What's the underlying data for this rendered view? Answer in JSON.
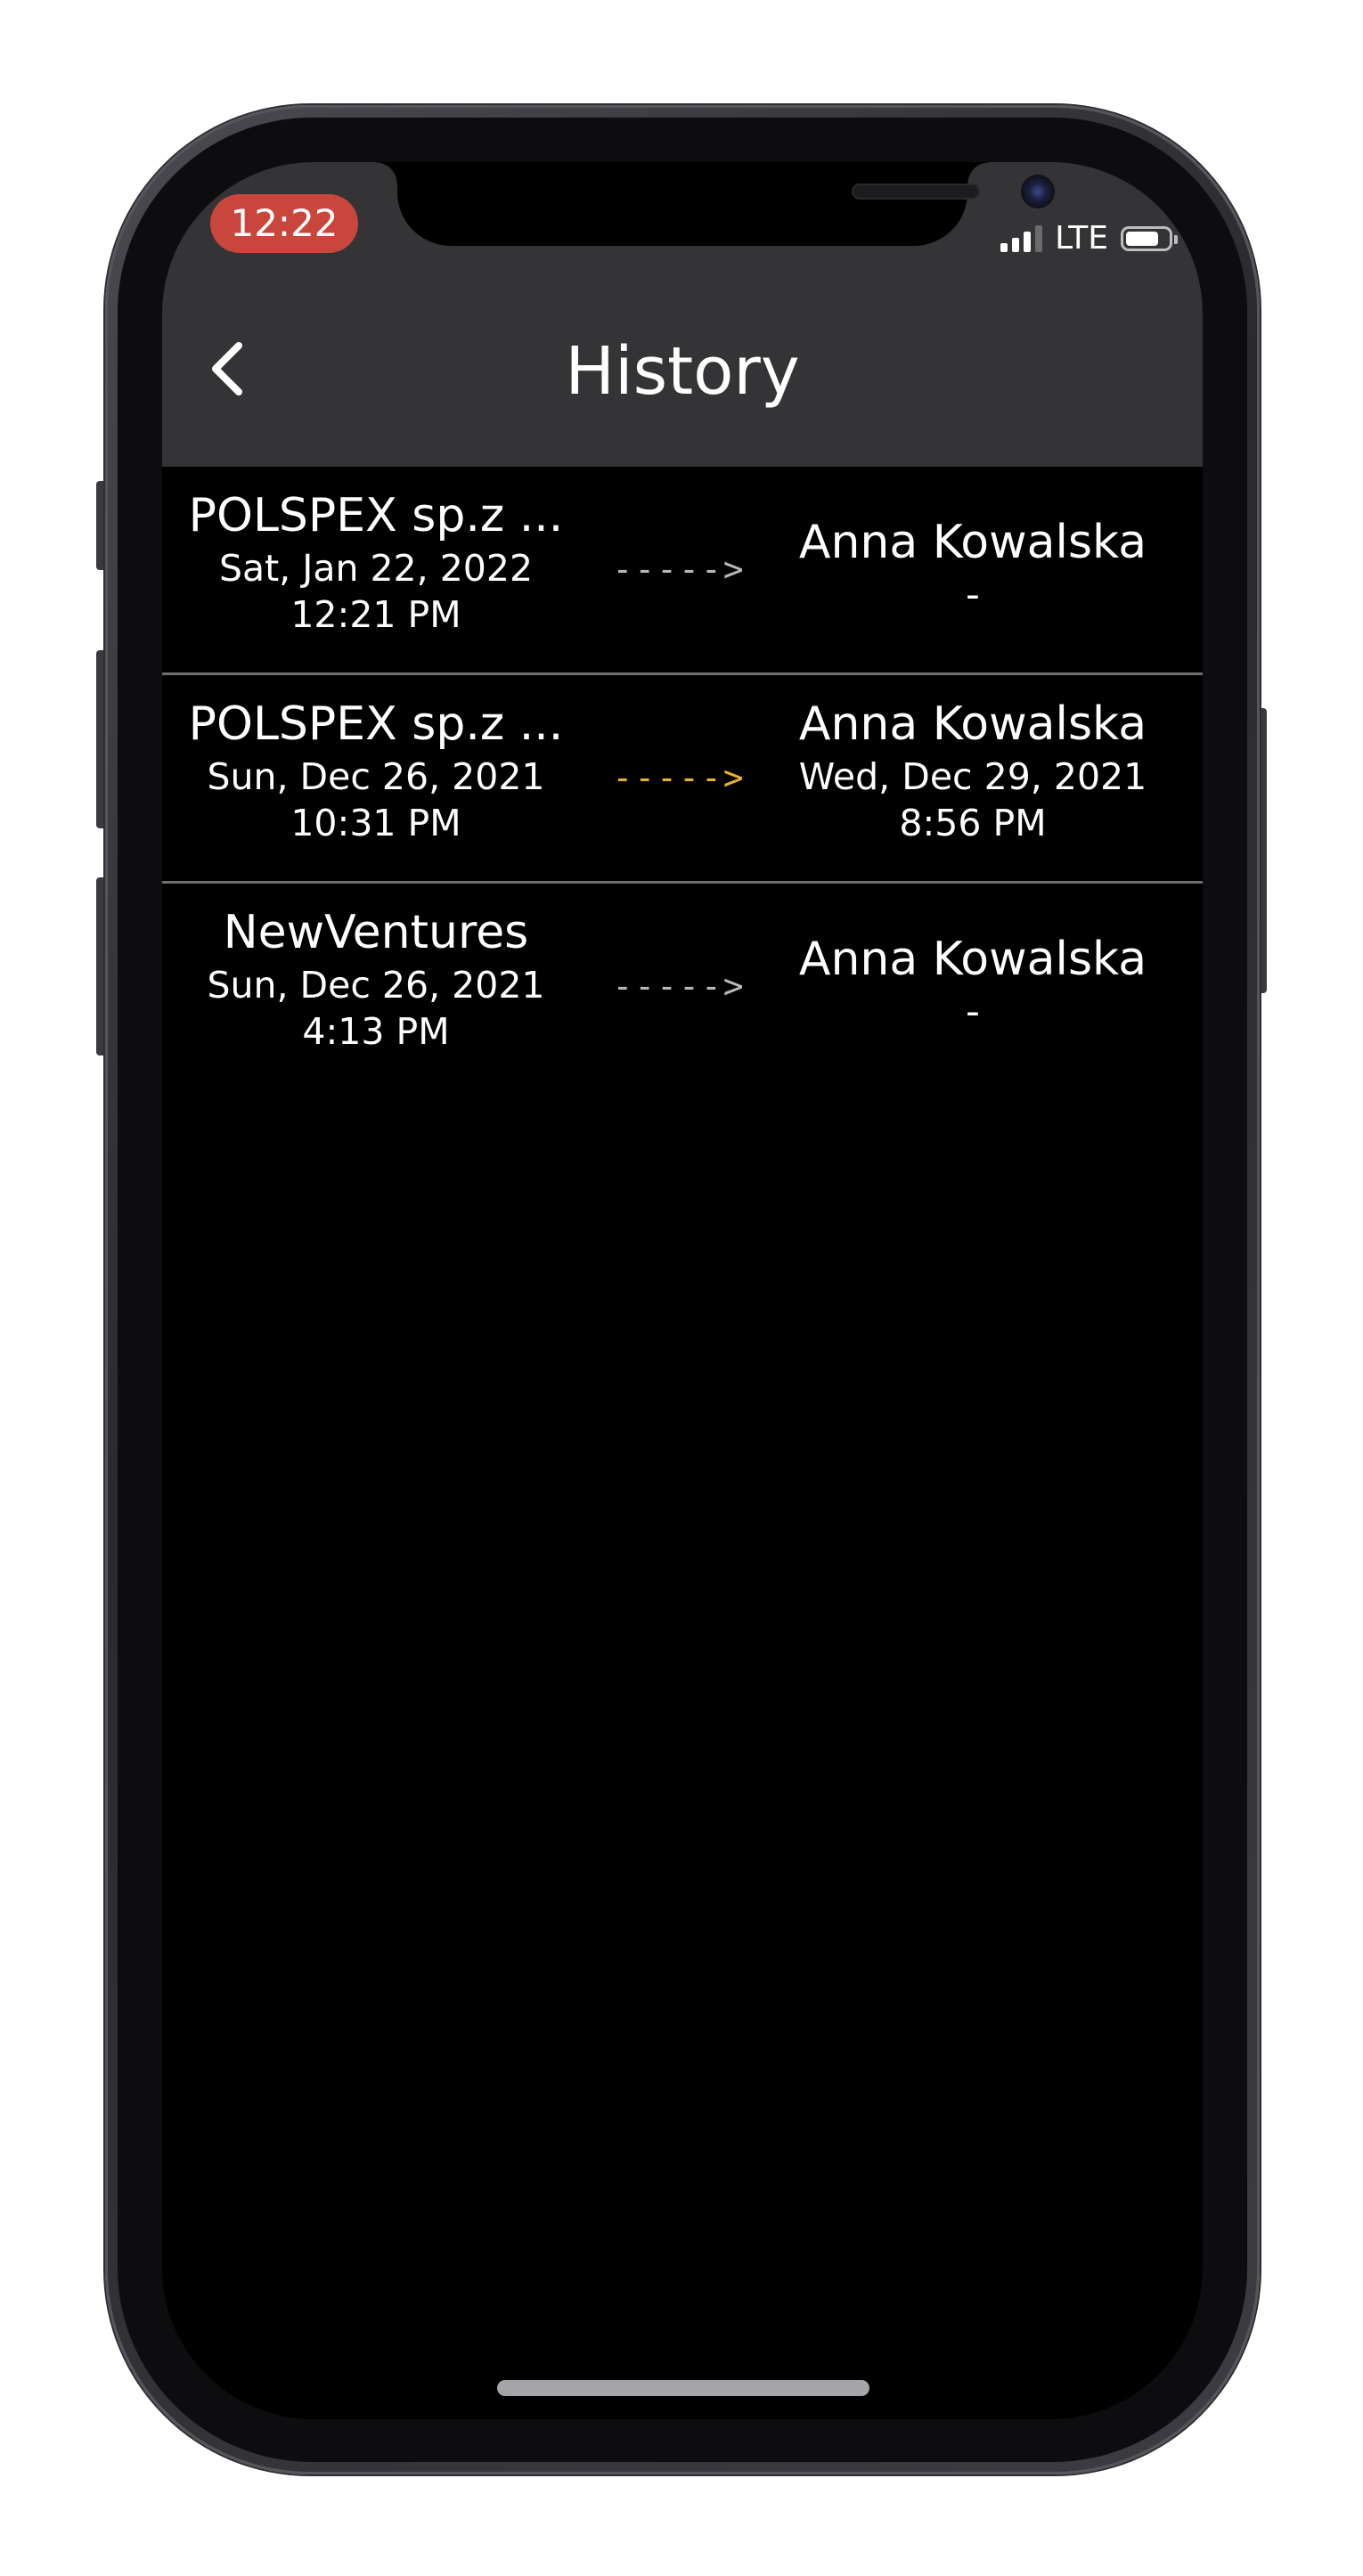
{
  "status_bar": {
    "time": "12:22",
    "network": "LTE",
    "time_badge_color": "#c8463c"
  },
  "nav": {
    "back_icon": "chevron-left-icon",
    "title": "History"
  },
  "history": [
    {
      "from_name": "POLSPEX sp.z ...",
      "from_date": "Sat, Jan 22, 2022",
      "from_time": "12:21 PM",
      "arrow": "----->",
      "arrow_color": "#b8b8bc",
      "to_name": "Anna Kowalska",
      "to_value": "-"
    },
    {
      "from_name": "POLSPEX sp.z ...",
      "from_date": "Sun, Dec 26, 2021",
      "from_time": "10:31 PM",
      "arrow": "----->",
      "arrow_color": "#e8b130",
      "to_name": "Anna Kowalska",
      "to_date": "Wed, Dec 29, 2021",
      "to_time": "8:56 PM"
    },
    {
      "from_name": "NewVentures",
      "from_date": "Sun, Dec 26, 2021",
      "from_time": "4:13 PM",
      "arrow": "----->",
      "arrow_color": "#b8b8bc",
      "to_name": "Anna Kowalska",
      "to_value": "-"
    }
  ]
}
